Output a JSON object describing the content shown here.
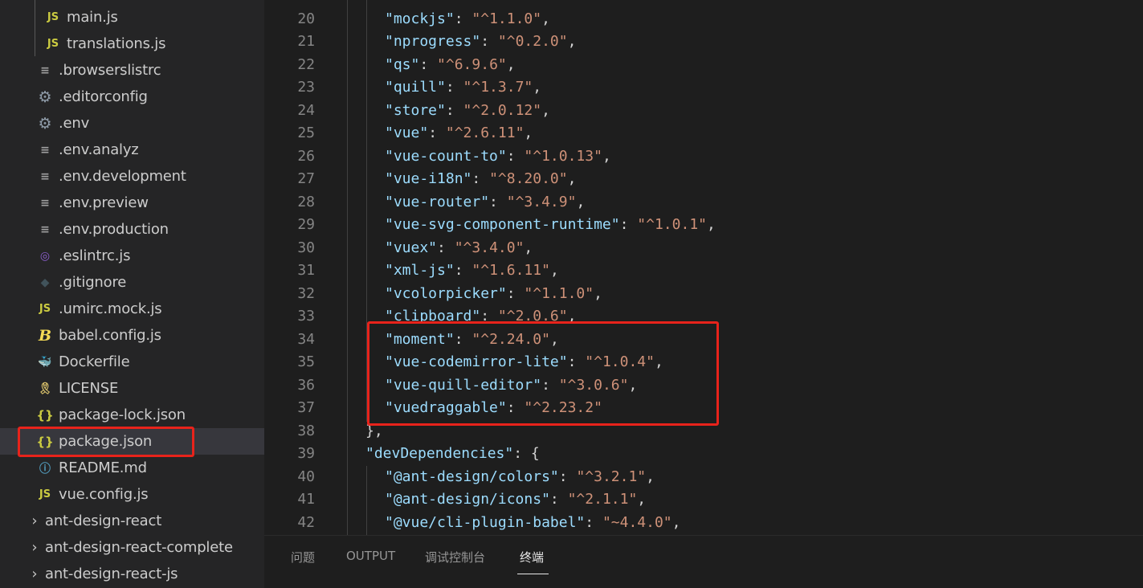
{
  "explorer": {
    "items": [
      {
        "label": "main.js",
        "icon": "js-icon",
        "glyph": "JS"
      },
      {
        "label": "translations.js",
        "icon": "js-icon",
        "glyph": "JS"
      },
      {
        "label": ".browserslistrc",
        "icon": "text-lines-icon",
        "glyph": "≡"
      },
      {
        "label": ".editorconfig",
        "icon": "gear-icon",
        "glyph": "⚙"
      },
      {
        "label": ".env",
        "icon": "gear-icon",
        "glyph": "⚙"
      },
      {
        "label": ".env.analyz",
        "icon": "text-lines-icon",
        "glyph": "≡"
      },
      {
        "label": ".env.development",
        "icon": "text-lines-icon",
        "glyph": "≡"
      },
      {
        "label": ".env.preview",
        "icon": "text-lines-icon",
        "glyph": "≡"
      },
      {
        "label": ".env.production",
        "icon": "text-lines-icon",
        "glyph": "≡"
      },
      {
        "label": ".eslintrc.js",
        "icon": "eslint-icon",
        "glyph": "◎"
      },
      {
        "label": ".gitignore",
        "icon": "git-icon",
        "glyph": "◆"
      },
      {
        "label": ".umirc.mock.js",
        "icon": "js-icon",
        "glyph": "JS"
      },
      {
        "label": "babel.config.js",
        "icon": "babel-icon",
        "glyph": "B"
      },
      {
        "label": "Dockerfile",
        "icon": "docker-icon",
        "glyph": "🐳"
      },
      {
        "label": "LICENSE",
        "icon": "license-icon",
        "glyph": "🎗"
      },
      {
        "label": "package-lock.json",
        "icon": "json-icon",
        "glyph": "{}"
      },
      {
        "label": "package.json",
        "icon": "json-icon",
        "glyph": "{}"
      },
      {
        "label": "README.md",
        "icon": "info-icon",
        "glyph": "ⓘ"
      },
      {
        "label": "vue.config.js",
        "icon": "js-icon",
        "glyph": "JS"
      }
    ],
    "folders": [
      {
        "label": "ant-design-react",
        "icon": "chevron-right-icon",
        "glyph": "›"
      },
      {
        "label": "ant-design-react-complete",
        "icon": "chevron-right-icon",
        "glyph": "›"
      },
      {
        "label": "ant-design-react-js",
        "icon": "chevron-right-icon",
        "glyph": "›"
      }
    ],
    "selected": "package.json"
  },
  "editor": {
    "lines": [
      {
        "n": "20",
        "key": "\"mockjs\"",
        "val": "\"^1.1.0\"",
        "end": ","
      },
      {
        "n": "21",
        "key": "\"nprogress\"",
        "val": "\"^0.2.0\"",
        "end": ","
      },
      {
        "n": "22",
        "key": "\"qs\"",
        "val": "\"^6.9.6\"",
        "end": ","
      },
      {
        "n": "23",
        "key": "\"quill\"",
        "val": "\"^1.3.7\"",
        "end": ","
      },
      {
        "n": "24",
        "key": "\"store\"",
        "val": "\"^2.0.12\"",
        "end": ","
      },
      {
        "n": "25",
        "key": "\"vue\"",
        "val": "\"^2.6.11\"",
        "end": ","
      },
      {
        "n": "26",
        "key": "\"vue-count-to\"",
        "val": "\"^1.0.13\"",
        "end": ","
      },
      {
        "n": "27",
        "key": "\"vue-i18n\"",
        "val": "\"^8.20.0\"",
        "end": ","
      },
      {
        "n": "28",
        "key": "\"vue-router\"",
        "val": "\"^3.4.9\"",
        "end": ","
      },
      {
        "n": "29",
        "key": "\"vue-svg-component-runtime\"",
        "val": "\"^1.0.1\"",
        "end": ","
      },
      {
        "n": "30",
        "key": "\"vuex\"",
        "val": "\"^3.4.0\"",
        "end": ","
      },
      {
        "n": "31",
        "key": "\"xml-js\"",
        "val": "\"^1.6.11\"",
        "end": ","
      },
      {
        "n": "32",
        "key": "\"vcolorpicker\"",
        "val": "\"^1.1.0\"",
        "end": ","
      },
      {
        "n": "33",
        "key": "\"clipboard\"",
        "val": "\"^2.0.6\"",
        "end": ","
      },
      {
        "n": "34",
        "key": "\"moment\"",
        "val": "\"^2.24.0\"",
        "end": ","
      },
      {
        "n": "35",
        "key": "\"vue-codemirror-lite\"",
        "val": "\"^1.0.4\"",
        "end": ","
      },
      {
        "n": "36",
        "key": "\"vue-quill-editor\"",
        "val": "\"^3.0.6\"",
        "end": ","
      },
      {
        "n": "37",
        "key": "\"vuedraggable\"",
        "val": "\"^2.23.2\"",
        "end": ""
      },
      {
        "n": "38",
        "raw": "},",
        "depth": 1
      },
      {
        "n": "39",
        "key": "\"devDependencies\"",
        "val": "{",
        "end": "",
        "depth": 1,
        "valIsPunct": true
      },
      {
        "n": "40",
        "key": "\"@ant-design/colors\"",
        "val": "\"^3.2.1\"",
        "end": ","
      },
      {
        "n": "41",
        "key": "\"@ant-design/icons\"",
        "val": "\"^2.1.1\"",
        "end": ","
      },
      {
        "n": "42",
        "key": "\"@vue/cli-plugin-babel\"",
        "val": "\"~4.4.0\"",
        "end": ","
      }
    ]
  },
  "panel": {
    "tabs": [
      {
        "label": "问题",
        "active": false
      },
      {
        "label": "OUTPUT",
        "active": false
      },
      {
        "label": "调试控制台",
        "active": false
      },
      {
        "label": "终端",
        "active": true
      }
    ]
  },
  "colors": {
    "highlight_box": "#e8231b",
    "json_key": "#9cdcfe",
    "json_string": "#ce9178"
  }
}
